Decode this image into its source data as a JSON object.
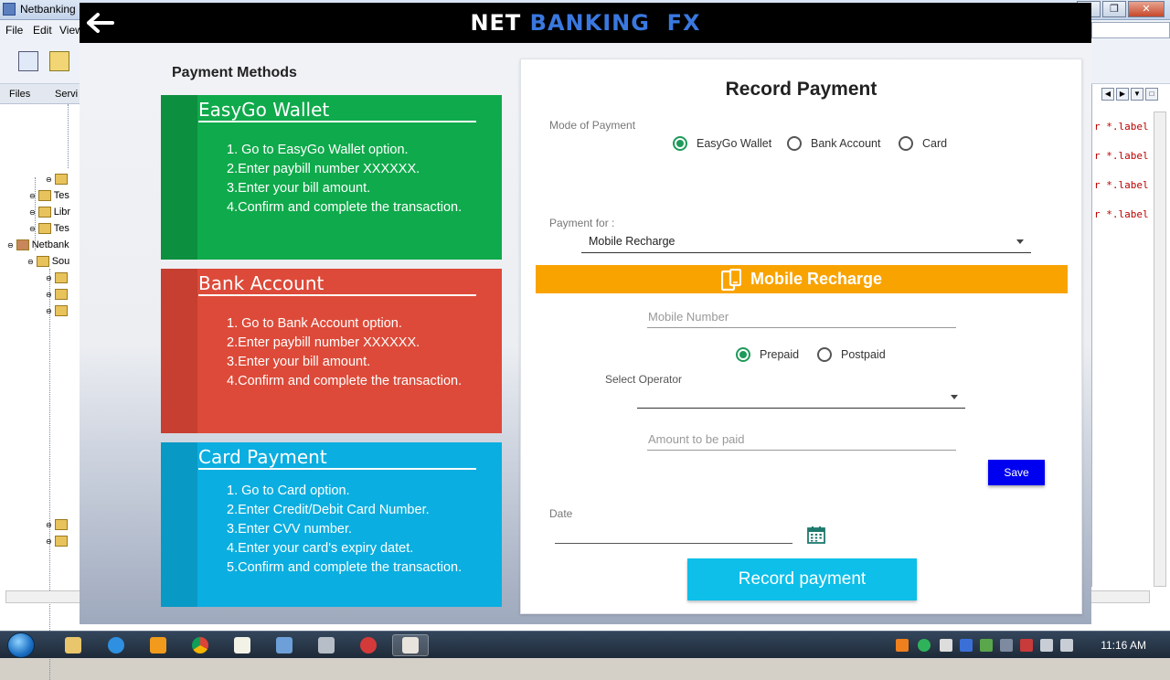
{
  "ide": {
    "title": "Netbanking",
    "menu": [
      "File",
      "Edit",
      "View"
    ],
    "tabs": [
      "Files",
      "Servi"
    ],
    "tree_items": [
      "Tes",
      "Libr",
      "Tes",
      "Netbank",
      "Sou"
    ],
    "code_lines": [
      "r *.label",
      "r *.label",
      "r *.label",
      "r *.label"
    ]
  },
  "taskbar": {
    "clock": "11:16 AM"
  },
  "app": {
    "brand_first": "NET",
    "brand_second": "BANKING  FX",
    "back_icon": "arrow-left-icon",
    "payment_methods_title": "Payment Methods",
    "cards": [
      {
        "title": "EasyGo Wallet",
        "color": "#0faa4b",
        "steps": [
          "1. Go to EasyGo Wallet option.",
          "2.Enter paybill number XXXXXX.",
          "3.Enter your bill amount.",
          "4.Confirm and complete the transaction."
        ]
      },
      {
        "title": "Bank Account",
        "color": "#dd4a39",
        "steps": [
          "1. Go to Bank Account option.",
          "2.Enter paybill number XXXXXX.",
          "3.Enter your bill amount.",
          "4.Confirm and complete the transaction."
        ]
      },
      {
        "title": "Card Payment",
        "color": "#0baee0",
        "steps": [
          "1. Go to Card option.",
          "2.Enter Credit/Debit Card Number.",
          "3.Enter CVV number.",
          "4.Enter your card's expiry datet.",
          "5.Confirm and complete the transaction."
        ]
      }
    ],
    "record": {
      "title": "Record Payment",
      "mode_label": "Mode of Payment",
      "modes": [
        {
          "label": "EasyGo Wallet",
          "selected": true
        },
        {
          "label": "Bank Account",
          "selected": false
        },
        {
          "label": "Card",
          "selected": false
        }
      ],
      "payment_for_label": "Payment for :",
      "payment_for_value": "Mobile Recharge",
      "banner_title": "Mobile Recharge",
      "banner_color": "#f9a300",
      "mobile_placeholder": "Mobile Number",
      "plan_options": [
        {
          "label": "Prepaid",
          "selected": true
        },
        {
          "label": "Postpaid",
          "selected": false
        }
      ],
      "operator_label": "Select Operator",
      "operator_value": "",
      "amount_placeholder": "Amount to be paid",
      "save_label": "Save",
      "date_label": "Date",
      "date_value": "",
      "record_button": "Record payment",
      "accent": "#1e9a5a"
    }
  }
}
